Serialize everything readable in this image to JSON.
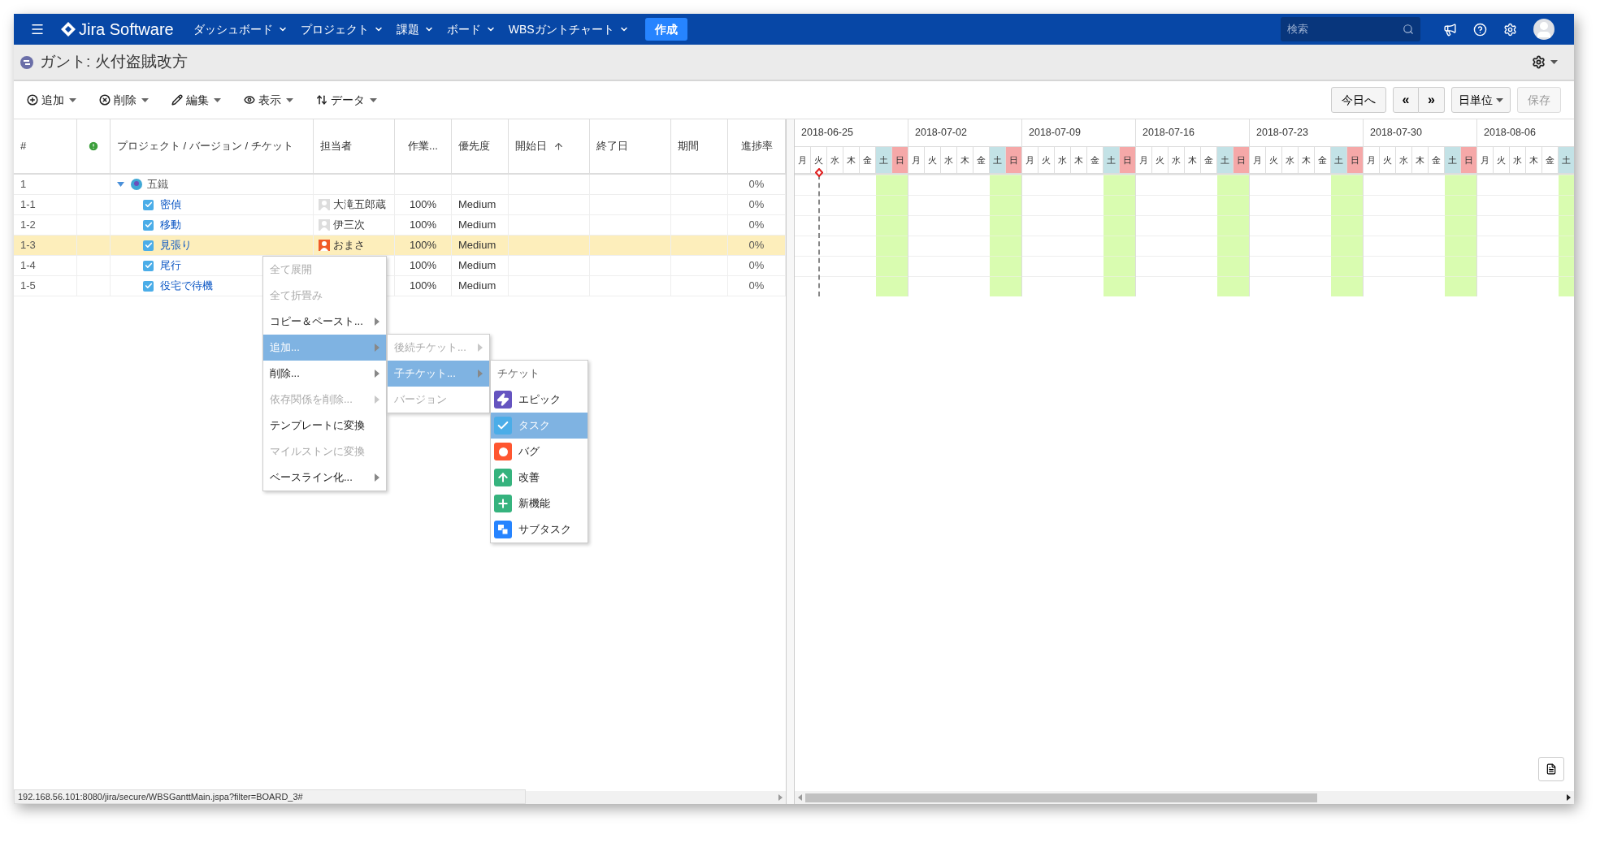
{
  "nav": {
    "brand": "Jira Software",
    "menus": [
      "ダッシュボード",
      "プロジェクト",
      "課題",
      "ボード",
      "WBSガントチャート"
    ],
    "create_button": "作成",
    "search": {
      "placeholder": "検索"
    }
  },
  "page_title": "ガント: 火付盗賊改方",
  "toolbar": {
    "left": [
      {
        "label": "追加",
        "kind": "add"
      },
      {
        "label": "削除",
        "kind": "delete"
      },
      {
        "label": "編集",
        "kind": "edit"
      },
      {
        "label": "表示",
        "kind": "view"
      },
      {
        "label": "データ",
        "kind": "data"
      }
    ],
    "today_button": "今日へ",
    "prev_button": "«",
    "next_button": "»",
    "unit_button": "日単位",
    "save_button": {
      "label": "保存",
      "disabled": true
    }
  },
  "table": {
    "columns": [
      {
        "label": "#",
        "kind": "text"
      },
      {
        "kind": "alert"
      },
      {
        "label": "プロジェクト / バージョン / チケット",
        "kind": "text"
      },
      {
        "label": "担当者",
        "kind": "text"
      },
      {
        "label": "作業...",
        "kind": "text"
      },
      {
        "label": "優先度",
        "kind": "text"
      },
      {
        "label": "開始日",
        "kind": "sorted"
      },
      {
        "label": "終了日",
        "kind": "text"
      },
      {
        "label": "期間",
        "kind": "text"
      },
      {
        "label": "進捗率",
        "kind": "text"
      }
    ],
    "rows": [
      {
        "id": "1",
        "name": "五鐵",
        "kind": "project",
        "expanded": true,
        "selected": false,
        "progress": "0%",
        "children": [
          {
            "id": "1-1",
            "name": "密偵",
            "kind": "task",
            "selected": false,
            "assignee": {
              "name": "大滝五郎蔵",
              "color": "#dddddd"
            },
            "work": "100%",
            "priority": "Medium",
            "progress": "0%"
          },
          {
            "id": "1-2",
            "name": "移動",
            "kind": "task",
            "selected": false,
            "assignee": {
              "name": "伊三次",
              "color": "#dddddd"
            },
            "work": "100%",
            "priority": "Medium",
            "progress": "0%"
          },
          {
            "id": "1-3",
            "name": "見張り",
            "kind": "task",
            "selected": true,
            "assignee": {
              "name": "おまさ",
              "color": "#f05a28"
            },
            "work": "100%",
            "priority": "Medium",
            "progress": "0%"
          },
          {
            "id": "1-4",
            "name": "尾行",
            "kind": "task",
            "selected": false,
            "work": "100%",
            "priority": "Medium",
            "progress": "0%"
          },
          {
            "id": "1-5",
            "name": "役宅で待機",
            "kind": "task",
            "selected": false,
            "work": "100%",
            "priority": "Medium",
            "progress": "0%"
          }
        ]
      }
    ]
  },
  "gantt": {
    "weeks": [
      {
        "date": "2018-06-25",
        "days": [
          {
            "label": "月",
            "kind": "weekday",
            "today": false
          },
          {
            "label": "火",
            "kind": "weekday",
            "today": true
          },
          {
            "label": "水",
            "kind": "weekday",
            "today": false
          },
          {
            "label": "木",
            "kind": "weekday",
            "today": false
          },
          {
            "label": "金",
            "kind": "weekday",
            "today": false
          },
          {
            "label": "土",
            "kind": "saturday",
            "today": false
          },
          {
            "label": "日",
            "kind": "sunday",
            "today": false
          }
        ]
      },
      {
        "date": "2018-07-02",
        "days": [
          {
            "label": "月",
            "kind": "weekday",
            "today": false
          },
          {
            "label": "火",
            "kind": "weekday",
            "today": false
          },
          {
            "label": "水",
            "kind": "weekday",
            "today": false
          },
          {
            "label": "木",
            "kind": "weekday",
            "today": false
          },
          {
            "label": "金",
            "kind": "weekday",
            "today": false
          },
          {
            "label": "土",
            "kind": "saturday",
            "today": false
          },
          {
            "label": "日",
            "kind": "sunday",
            "today": false
          }
        ]
      },
      {
        "date": "2018-07-09",
        "days": [
          {
            "label": "月",
            "kind": "weekday",
            "today": false
          },
          {
            "label": "火",
            "kind": "weekday",
            "today": false
          },
          {
            "label": "水",
            "kind": "weekday",
            "today": false
          },
          {
            "label": "木",
            "kind": "weekday",
            "today": false
          },
          {
            "label": "金",
            "kind": "weekday",
            "today": false
          },
          {
            "label": "土",
            "kind": "saturday",
            "today": false
          },
          {
            "label": "日",
            "kind": "sunday",
            "today": false
          }
        ]
      },
      {
        "date": "2018-07-16",
        "days": [
          {
            "label": "月",
            "kind": "weekday",
            "today": false
          },
          {
            "label": "火",
            "kind": "weekday",
            "today": false
          },
          {
            "label": "水",
            "kind": "weekday",
            "today": false
          },
          {
            "label": "木",
            "kind": "weekday",
            "today": false
          },
          {
            "label": "金",
            "kind": "weekday",
            "today": false
          },
          {
            "label": "土",
            "kind": "saturday",
            "today": false
          },
          {
            "label": "日",
            "kind": "sunday",
            "today": false
          }
        ]
      },
      {
        "date": "2018-07-23",
        "days": [
          {
            "label": "月",
            "kind": "weekday",
            "today": false
          },
          {
            "label": "火",
            "kind": "weekday",
            "today": false
          },
          {
            "label": "水",
            "kind": "weekday",
            "today": false
          },
          {
            "label": "木",
            "kind": "weekday",
            "today": false
          },
          {
            "label": "金",
            "kind": "weekday",
            "today": false
          },
          {
            "label": "土",
            "kind": "saturday",
            "today": false
          },
          {
            "label": "日",
            "kind": "sunday",
            "today": false
          }
        ]
      },
      {
        "date": "2018-07-30",
        "days": [
          {
            "label": "月",
            "kind": "weekday",
            "today": false
          },
          {
            "label": "火",
            "kind": "weekday",
            "today": false
          },
          {
            "label": "水",
            "kind": "weekday",
            "today": false
          },
          {
            "label": "木",
            "kind": "weekday",
            "today": false
          },
          {
            "label": "金",
            "kind": "weekday",
            "today": false
          },
          {
            "label": "土",
            "kind": "saturday",
            "today": false
          },
          {
            "label": "日",
            "kind": "sunday",
            "today": false
          }
        ]
      },
      {
        "date": "2018-08-06",
        "days": [
          {
            "label": "月",
            "kind": "weekday",
            "today": false
          },
          {
            "label": "火",
            "kind": "weekday",
            "today": false
          },
          {
            "label": "水",
            "kind": "weekday",
            "today": false
          },
          {
            "label": "木",
            "kind": "weekday",
            "today": false
          },
          {
            "label": "金",
            "kind": "weekday",
            "today": false
          },
          {
            "label": "土",
            "kind": "saturday",
            "today": false
          }
        ]
      }
    ]
  },
  "context_menu": {
    "items": [
      {
        "label": "全て展開",
        "disabled": true,
        "has_submenu": false,
        "selected": false
      },
      {
        "label": "全て折畳み",
        "disabled": true,
        "has_submenu": false,
        "selected": false
      },
      {
        "label": "コピー＆ペースト...",
        "disabled": false,
        "has_submenu": true,
        "selected": false
      },
      {
        "label": "追加...",
        "disabled": false,
        "has_submenu": true,
        "selected": true
      },
      {
        "label": "削除...",
        "disabled": false,
        "has_submenu": true,
        "selected": false
      },
      {
        "label": "依存関係を削除...",
        "disabled": true,
        "has_submenu": true,
        "selected": false
      },
      {
        "label": "テンプレートに変換",
        "disabled": false,
        "has_submenu": false,
        "selected": false
      },
      {
        "label": "マイルストンに変換",
        "disabled": true,
        "has_submenu": false,
        "selected": false
      },
      {
        "label": "ベースライン化...",
        "disabled": false,
        "has_submenu": true,
        "selected": false
      }
    ],
    "submenu": [
      {
        "label": "後続チケット...",
        "disabled": true,
        "has_submenu": true,
        "selected": false
      },
      {
        "label": "子チケット...",
        "disabled": false,
        "has_submenu": true,
        "selected": true
      },
      {
        "label": "バージョン",
        "disabled": true,
        "has_submenu": false,
        "selected": false
      }
    ],
    "issue_types": {
      "header": "チケット",
      "items": [
        {
          "label": "エピック",
          "kind": "epic",
          "selected": false
        },
        {
          "label": "タスク",
          "kind": "task",
          "selected": true
        },
        {
          "label": "バグ",
          "kind": "bug",
          "selected": false
        },
        {
          "label": "改善",
          "kind": "improvement",
          "selected": false
        },
        {
          "label": "新機能",
          "kind": "feature",
          "selected": false
        },
        {
          "label": "サブタスク",
          "kind": "subtask",
          "selected": false
        }
      ]
    }
  },
  "status_url": "192.168.56.101:8080/jira/secure/WBSGanttMain.jspa?filter=BOARD_3#"
}
